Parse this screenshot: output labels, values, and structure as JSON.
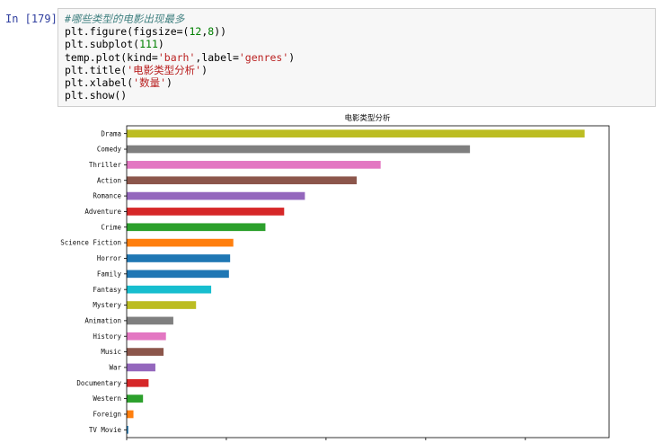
{
  "cell": {
    "prompt": "In [179]:",
    "lines": [
      {
        "parts": [
          {
            "t": "#哪些类型的电影出现最多",
            "c": "comment"
          }
        ]
      },
      {
        "parts": [
          {
            "t": "plt.figure(figsize=(",
            "c": "kw"
          },
          {
            "t": "12",
            "c": "num"
          },
          {
            "t": ",",
            "c": "kw"
          },
          {
            "t": "8",
            "c": "num"
          },
          {
            "t": "))",
            "c": "kw"
          }
        ]
      },
      {
        "parts": [
          {
            "t": "plt.subplot(",
            "c": "kw"
          },
          {
            "t": "111",
            "c": "num"
          },
          {
            "t": ")",
            "c": "kw"
          }
        ]
      },
      {
        "parts": [
          {
            "t": "temp.plot(kind=",
            "c": "kw"
          },
          {
            "t": "'barh'",
            "c": "str"
          },
          {
            "t": ",label=",
            "c": "kw"
          },
          {
            "t": "'genres'",
            "c": "str"
          },
          {
            "t": ")",
            "c": "kw"
          }
        ]
      },
      {
        "parts": [
          {
            "t": "plt.title(",
            "c": "kw"
          },
          {
            "t": "'电影类型分析'",
            "c": "str"
          },
          {
            "t": ")",
            "c": "kw"
          }
        ]
      },
      {
        "parts": [
          {
            "t": "plt.xlabel(",
            "c": "kw"
          },
          {
            "t": "'数量'",
            "c": "str"
          },
          {
            "t": ")",
            "c": "kw"
          }
        ]
      },
      {
        "parts": [
          {
            "t": "plt.show()",
            "c": "kw"
          }
        ]
      }
    ]
  },
  "chart_data": {
    "type": "bar",
    "orientation": "horizontal",
    "title": "电影类型分析",
    "xlabel": "",
    "ylabel": "",
    "grid": false,
    "xlim": [
      0,
      2420
    ],
    "categories": [
      "Drama",
      "Comedy",
      "Thriller",
      "Action",
      "Romance",
      "Adventure",
      "Crime",
      "Science Fiction",
      "Horror",
      "Family",
      "Fantasy",
      "Mystery",
      "Animation",
      "History",
      "Music",
      "War",
      "Documentary",
      "Western",
      "Foreign",
      "TV Movie"
    ],
    "values": [
      2297,
      1722,
      1274,
      1154,
      894,
      790,
      696,
      535,
      519,
      513,
      424,
      348,
      234,
      197,
      185,
      144,
      110,
      82,
      34,
      8
    ],
    "colors": [
      "#bcbd22",
      "#7f7f7f",
      "#e377c2",
      "#8c564b",
      "#9467bd",
      "#d62728",
      "#2ca02c",
      "#ff7f0e",
      "#1f77b4",
      "#1f77b4",
      "#17becf",
      "#bcbd22",
      "#7f7f7f",
      "#e377c2",
      "#8c564b",
      "#9467bd",
      "#d62728",
      "#2ca02c",
      "#ff7f0e",
      "#1f77b4"
    ]
  }
}
